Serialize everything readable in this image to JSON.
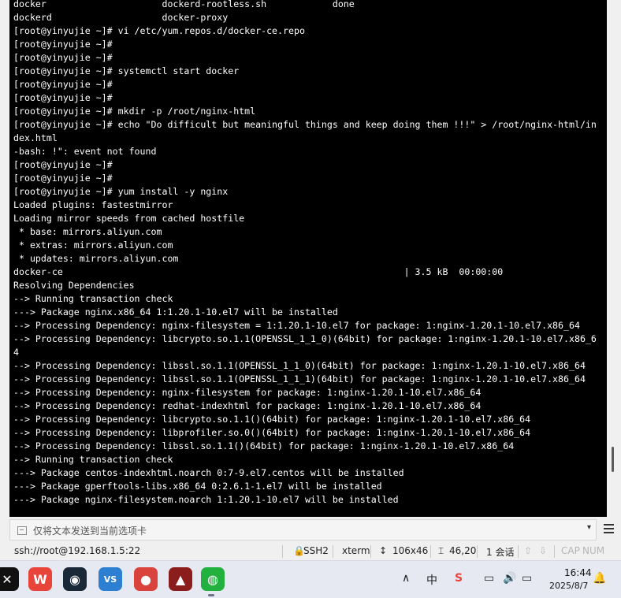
{
  "terminal": {
    "lines": [
      "docker                     dockerd-rootless.sh            done",
      "dockerd                    docker-proxy",
      "[root@yinyujie ~]# vi /etc/yum.repos.d/docker-ce.repo",
      "[root@yinyujie ~]#",
      "[root@yinyujie ~]#",
      "[root@yinyujie ~]# systemctl start docker",
      "[root@yinyujie ~]#",
      "[root@yinyujie ~]#",
      "[root@yinyujie ~]# mkdir -p /root/nginx-html",
      "[root@yinyujie ~]# echo \"Do difficult but meaningful things and keep doing them !!!\" > /root/nginx-html/in",
      "dex.html",
      "-bash: !\": event not found",
      "[root@yinyujie ~]#",
      "[root@yinyujie ~]#",
      "[root@yinyujie ~]# yum install -y nginx",
      "Loaded plugins: fastestmirror",
      "Loading mirror speeds from cached hostfile",
      " * base: mirrors.aliyun.com",
      " * extras: mirrors.aliyun.com",
      " * updates: mirrors.aliyun.com",
      "docker-ce                                                              | 3.5 kB  00:00:00",
      "Resolving Dependencies",
      "--> Running transaction check",
      "---> Package nginx.x86_64 1:1.20.1-10.el7 will be installed",
      "--> Processing Dependency: nginx-filesystem = 1:1.20.1-10.el7 for package: 1:nginx-1.20.1-10.el7.x86_64",
      "--> Processing Dependency: libcrypto.so.1.1(OPENSSL_1_1_0)(64bit) for package: 1:nginx-1.20.1-10.el7.x86_6",
      "4",
      "--> Processing Dependency: libssl.so.1.1(OPENSSL_1_1_0)(64bit) for package: 1:nginx-1.20.1-10.el7.x86_64",
      "--> Processing Dependency: libssl.so.1.1(OPENSSL_1_1_1)(64bit) for package: 1:nginx-1.20.1-10.el7.x86_64",
      "--> Processing Dependency: nginx-filesystem for package: 1:nginx-1.20.1-10.el7.x86_64",
      "--> Processing Dependency: redhat-indexhtml for package: 1:nginx-1.20.1-10.el7.x86_64",
      "--> Processing Dependency: libcrypto.so.1.1()(64bit) for package: 1:nginx-1.20.1-10.el7.x86_64",
      "--> Processing Dependency: libprofiler.so.0()(64bit) for package: 1:nginx-1.20.1-10.el7.x86_64",
      "--> Processing Dependency: libssl.so.1.1()(64bit) for package: 1:nginx-1.20.1-10.el7.x86_64",
      "--> Running transaction check",
      "---> Package centos-indexhtml.noarch 0:7-9.el7.centos will be installed",
      "---> Package gperftools-libs.x86_64 0:2.6.1-1.el7 will be installed",
      "---> Package nginx-filesystem.noarch 1:1.20.1-10.el7 will be installed"
    ]
  },
  "sendbar": {
    "placeholder": "仅将文本发送到当前选项卡",
    "dropdown_icon": "▾",
    "menu_icon": "hamburger-menu-icon"
  },
  "statusbar": {
    "connection": "ssh://root@192.168.1.5:22",
    "protocol": "SSH2",
    "terminal_type": "xterm",
    "size": "106x46",
    "cursor": "46,20",
    "sessions": "1 会话",
    "caps": "CAP",
    "num": "NUM"
  },
  "taskbar": {
    "apps": [
      {
        "name": "capcut",
        "glyph": "✕",
        "color": "#111111"
      },
      {
        "name": "wps",
        "glyph": "W",
        "color": "#e8443a"
      },
      {
        "name": "steam",
        "glyph": "◉",
        "color": "#1b2838"
      },
      {
        "name": "visual-studio",
        "glyph": "VS",
        "color": "#2c7fd1"
      },
      {
        "name": "xshell",
        "glyph": "●",
        "color": "#d9433b"
      },
      {
        "name": "game",
        "glyph": "▲",
        "color": "#8c1d1d"
      },
      {
        "name": "wechat",
        "glyph": "◍",
        "color": "#22b13f"
      }
    ],
    "tray": {
      "chevron": "∧",
      "ime": "中",
      "time": "16:44",
      "date": "2025/8/7"
    }
  }
}
